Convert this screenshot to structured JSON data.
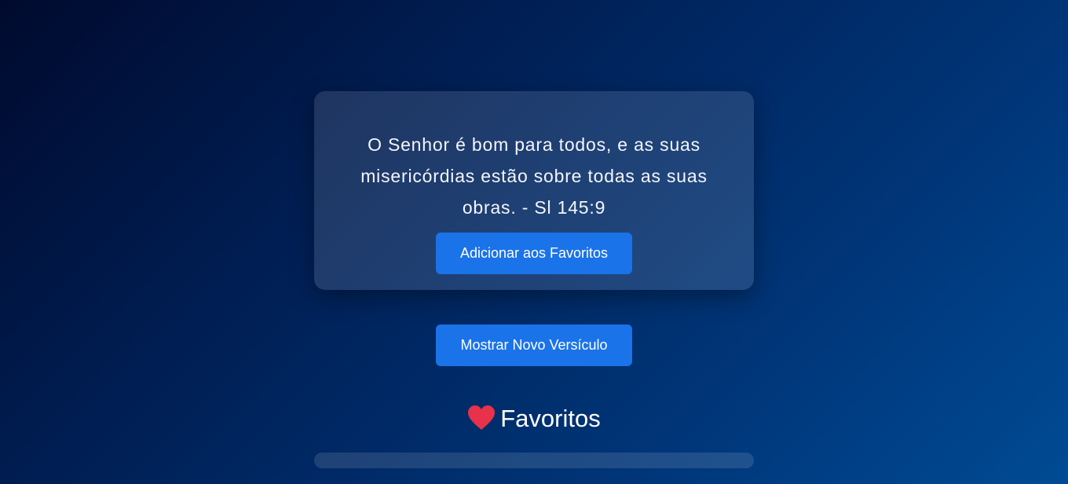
{
  "verse_card": {
    "text": "O Senhor é bom para todos, e as suas misericórdias estão sobre todas as suas obras. - Sl 145:9",
    "add_favorite_label": "Adicionar aos Favoritos"
  },
  "new_verse_label": "Mostrar Novo Versículo",
  "favorites": {
    "heading": "Favoritos",
    "icon": "heart-icon",
    "items": []
  },
  "colors": {
    "button": "#1a73e8",
    "heart": "#e8314a",
    "background_start": "#000a2e",
    "background_end": "#004b94"
  }
}
